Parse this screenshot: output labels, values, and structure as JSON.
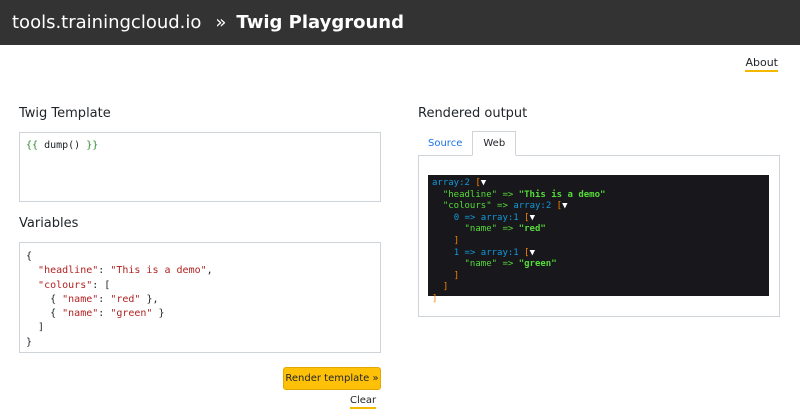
{
  "header": {
    "site": "tools.trainingcloud.io",
    "separator": "»",
    "title": "Twig Playground"
  },
  "about_link": "About",
  "template_section": {
    "label": "Twig Template",
    "code": {
      "open": "{{",
      "expr": " dump() ",
      "close": "}}"
    }
  },
  "variables_section": {
    "label": "Variables",
    "lines": [
      {
        "indent": "",
        "parts": [
          {
            "t": "{",
            "c": "p"
          }
        ]
      },
      {
        "indent": "  ",
        "parts": [
          {
            "t": "\"headline\"",
            "c": "k"
          },
          {
            "t": ": ",
            "c": "p"
          },
          {
            "t": "\"This is a demo\"",
            "c": "s"
          },
          {
            "t": ",",
            "c": "p"
          }
        ]
      },
      {
        "indent": "  ",
        "parts": [
          {
            "t": "\"colours\"",
            "c": "k"
          },
          {
            "t": ": [",
            "c": "p"
          }
        ]
      },
      {
        "indent": "    ",
        "parts": [
          {
            "t": "{ ",
            "c": "p"
          },
          {
            "t": "\"name\"",
            "c": "k"
          },
          {
            "t": ": ",
            "c": "p"
          },
          {
            "t": "\"red\"",
            "c": "s"
          },
          {
            "t": " },",
            "c": "p"
          }
        ]
      },
      {
        "indent": "    ",
        "parts": [
          {
            "t": "{ ",
            "c": "p"
          },
          {
            "t": "\"name\"",
            "c": "k"
          },
          {
            "t": ": ",
            "c": "p"
          },
          {
            "t": "\"green\"",
            "c": "s"
          },
          {
            "t": " }",
            "c": "p"
          }
        ]
      },
      {
        "indent": "  ",
        "parts": [
          {
            "t": "]",
            "c": "p"
          }
        ]
      },
      {
        "indent": "",
        "parts": [
          {
            "t": "}",
            "c": "p"
          }
        ]
      }
    ]
  },
  "buttons": {
    "render": "Render template »",
    "clear": "Clear"
  },
  "output_section": {
    "label": "Rendered output",
    "tabs": [
      "Source",
      "Web"
    ],
    "active_tab": "Web",
    "dump_lines": [
      {
        "indent": "",
        "parts": [
          {
            "t": "array:2",
            "c": "d-type"
          },
          {
            "t": " [",
            "c": "d-br"
          },
          {
            "t": "▼",
            "c": "d-arr"
          }
        ]
      },
      {
        "indent": "  ",
        "parts": [
          {
            "t": "\"headline\"",
            "c": "d-key"
          },
          {
            "t": " => ",
            "c": "d-op"
          },
          {
            "t": "\"This is a demo\"",
            "c": "d-str"
          }
        ]
      },
      {
        "indent": "  ",
        "parts": [
          {
            "t": "\"colours\"",
            "c": "d-key"
          },
          {
            "t": " => ",
            "c": "d-op"
          },
          {
            "t": "array:2",
            "c": "d-type"
          },
          {
            "t": " [",
            "c": "d-br"
          },
          {
            "t": "▼",
            "c": "d-arr"
          }
        ]
      },
      {
        "indent": "    ",
        "parts": [
          {
            "t": "0",
            "c": "d-type"
          },
          {
            "t": " => ",
            "c": "d-type"
          },
          {
            "t": "array:1",
            "c": "d-type"
          },
          {
            "t": " [",
            "c": "d-br"
          },
          {
            "t": "▼",
            "c": "d-arr"
          }
        ]
      },
      {
        "indent": "      ",
        "parts": [
          {
            "t": "\"name\"",
            "c": "d-key"
          },
          {
            "t": " => ",
            "c": "d-op"
          },
          {
            "t": "\"red\"",
            "c": "d-str"
          }
        ]
      },
      {
        "indent": "    ",
        "parts": [
          {
            "t": "]",
            "c": "d-br"
          }
        ]
      },
      {
        "indent": "    ",
        "parts": [
          {
            "t": "1",
            "c": "d-type"
          },
          {
            "t": " => ",
            "c": "d-type"
          },
          {
            "t": "array:1",
            "c": "d-type"
          },
          {
            "t": " [",
            "c": "d-br"
          },
          {
            "t": "▼",
            "c": "d-arr"
          }
        ]
      },
      {
        "indent": "      ",
        "parts": [
          {
            "t": "\"name\"",
            "c": "d-key"
          },
          {
            "t": " => ",
            "c": "d-op"
          },
          {
            "t": "\"green\"",
            "c": "d-str"
          }
        ]
      },
      {
        "indent": "    ",
        "parts": [
          {
            "t": "]",
            "c": "d-br"
          }
        ]
      },
      {
        "indent": "  ",
        "parts": [
          {
            "t": "]",
            "c": "d-br"
          }
        ]
      },
      {
        "indent": "",
        "parts": [
          {
            "t": "]",
            "c": "d-br"
          }
        ]
      }
    ]
  },
  "colors": {
    "header_bg": "#333333",
    "accent": "#ffc107",
    "tab_link": "#1a73e8",
    "dump_bg": "#18171b"
  }
}
